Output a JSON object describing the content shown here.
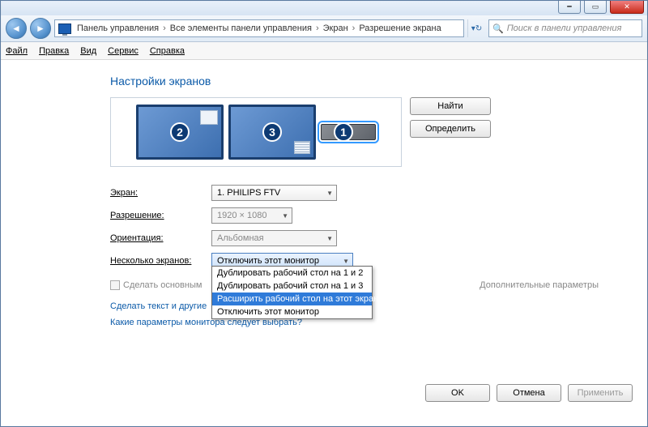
{
  "titlebar": {
    "min_glyph": "━",
    "max_glyph": "▭",
    "close_glyph": "✕"
  },
  "nav": {
    "back_glyph": "◄",
    "fwd_glyph": "►",
    "crumbs": [
      "Панель управления",
      "Все элементы панели управления",
      "Экран",
      "Разрешение экрана"
    ],
    "sep": "›",
    "refresh": "↻",
    "search_placeholder": "Поиск в панели управления",
    "search_icon": "🔍"
  },
  "menu": {
    "items": [
      "Файл",
      "Правка",
      "Вид",
      "Сервис",
      "Справка"
    ]
  },
  "page": {
    "title": "Настройки экранов",
    "find_btn": "Найти",
    "identify_btn": "Определить",
    "monitors": [
      {
        "num": "2"
      },
      {
        "num": "3"
      },
      {
        "num": "1"
      }
    ],
    "form": {
      "display_label": "Экран:",
      "display_value": "1. PHILIPS FTV",
      "res_label": "Разрешение:",
      "res_value": "1920 × 1080",
      "ori_label": "Ориентация:",
      "ori_value": "Альбомная",
      "multi_label": "Несколько экранов:",
      "multi_value": "Отключить этот монитор",
      "multi_options": [
        "Дублировать рабочий стол на 1 и 2",
        "Дублировать рабочий стол на 1 и 3",
        "Расширить рабочий стол на этот экран",
        "Отключить этот монитор"
      ],
      "multi_highlight_index": 2,
      "make_main": "Сделать основным",
      "advanced": "Дополнительные параметры",
      "link1_prefix": "Сделать текст и другие",
      "link2": "Какие параметры монитора следует выбрать?"
    },
    "buttons": {
      "ok": "OK",
      "cancel": "Отмена",
      "apply": "Применить"
    }
  }
}
